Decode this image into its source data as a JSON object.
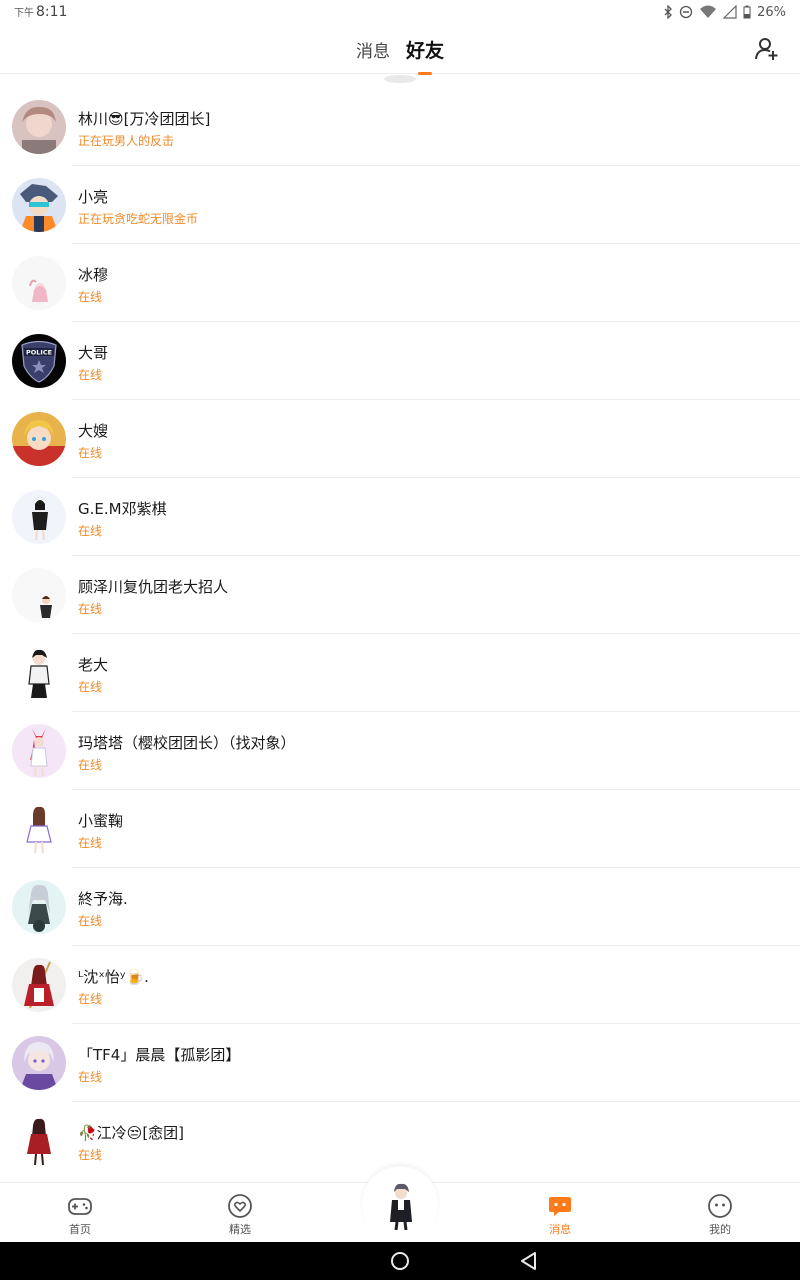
{
  "status_bar": {
    "prefix": "下午",
    "time": "8:11",
    "battery": "26%",
    "icons": [
      "bluetooth-icon",
      "dnd-icon",
      "wifi-icon",
      "signal-icon",
      "battery-icon"
    ]
  },
  "tabs": [
    {
      "label": "消息",
      "active": false
    },
    {
      "label": "好友",
      "active": true
    }
  ],
  "colors": {
    "accent": "#ff7a1a",
    "status_text": "#f08a2a"
  },
  "friends": [
    {
      "name": "林川😎[万冷团团长]",
      "status": "正在玩男人的反击"
    },
    {
      "name": "小亮",
      "status": "正在玩贪吃蛇无限金币"
    },
    {
      "name": "冰穆",
      "status": "在线"
    },
    {
      "name": "大哥",
      "status": "在线"
    },
    {
      "name": "大嫂",
      "status": "在线"
    },
    {
      "name": "G.E.M邓紫棋",
      "status": "在线"
    },
    {
      "name": "顾泽川复仇团老大招人",
      "status": "在线"
    },
    {
      "name": "老大",
      "status": "在线"
    },
    {
      "name": "玛塔塔（樱校团团长）（找对象）",
      "status": "在线"
    },
    {
      "name": "小蜜鞠",
      "status": "在线"
    },
    {
      "name": "終予海.",
      "status": "在线"
    },
    {
      "name": "ᴸ沈ˣ怡ʸ🍺.",
      "status": "在线"
    },
    {
      "name": "「TF4」晨晨【孤影团】",
      "status": "在线"
    },
    {
      "name": "🥀江冷😒[悆团]",
      "status": "在线"
    }
  ],
  "avatar_badge_text": "POLICE",
  "bottom_nav": [
    {
      "label": "首页",
      "icon": "gamepad-icon",
      "active": false
    },
    {
      "label": "精选",
      "icon": "heart-icon",
      "active": false
    },
    {
      "label": "消息",
      "icon": "chat-icon",
      "active": true
    },
    {
      "label": "我的",
      "icon": "face-icon",
      "active": false
    }
  ]
}
